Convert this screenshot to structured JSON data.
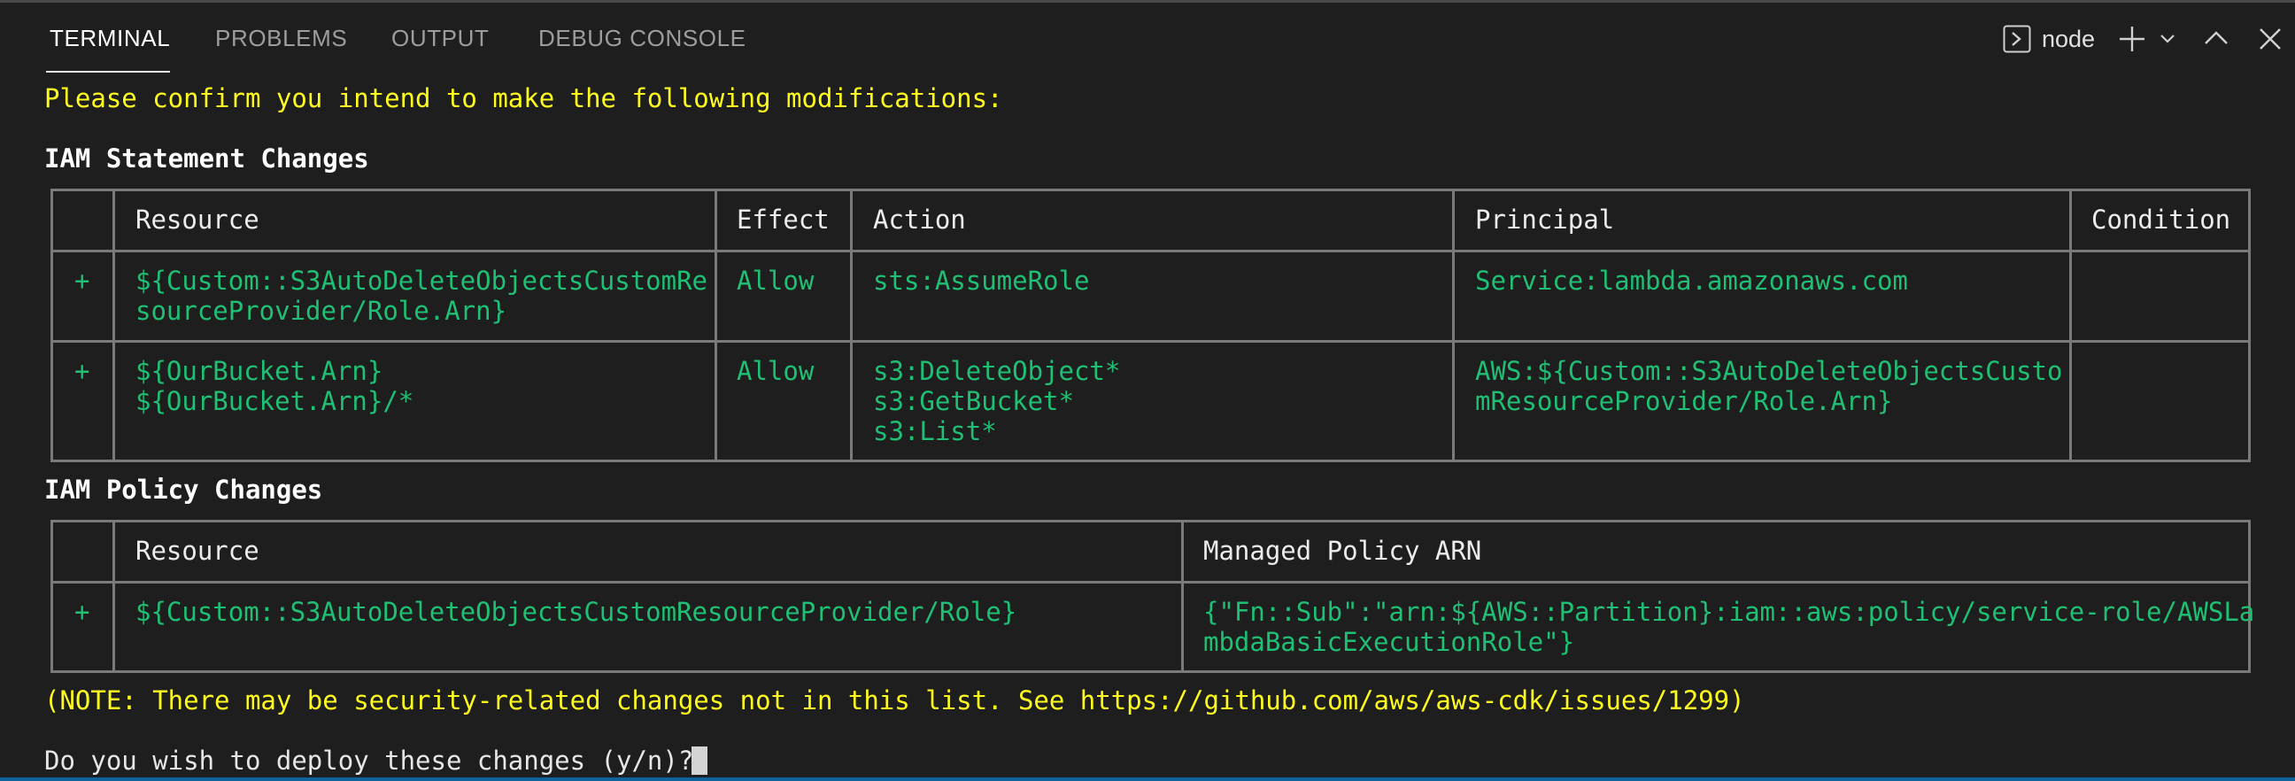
{
  "panel": {
    "tabs": [
      {
        "label": "TERMINAL",
        "active": true
      },
      {
        "label": "PROBLEMS",
        "active": false
      },
      {
        "label": "OUTPUT",
        "active": false
      },
      {
        "label": "DEBUG CONSOLE",
        "active": false
      }
    ],
    "shell_name": "node",
    "icons": [
      "terminal-icon",
      "plus-icon",
      "chevron-down-icon",
      "chevron-up-icon",
      "close-icon"
    ]
  },
  "terminal": {
    "confirm_prompt": "Please confirm you intend to make the following modifications:",
    "iam_statement_heading": "IAM Statement Changes",
    "statement_table": {
      "headers": [
        "",
        "Resource",
        "Effect",
        "Action",
        "Principal",
        "Condition"
      ],
      "rows": [
        {
          "marker": "+",
          "resource": [
            "${Custom::S3AutoDeleteObjectsCustomRe",
            "sourceProvider/Role.Arn}"
          ],
          "effect": "Allow",
          "action": [
            "sts:AssumeRole"
          ],
          "principal": [
            "Service:lambda.amazonaws.com"
          ],
          "condition": ""
        },
        {
          "marker": "+",
          "resource": [
            "${OurBucket.Arn}",
            "${OurBucket.Arn}/*"
          ],
          "effect": "Allow",
          "action": [
            "s3:DeleteObject*",
            "s3:GetBucket*",
            "s3:List*"
          ],
          "principal": [
            "AWS:${Custom::S3AutoDeleteObjectsCusto",
            "mResourceProvider/Role.Arn}"
          ],
          "condition": ""
        }
      ]
    },
    "iam_policy_heading": "IAM Policy Changes",
    "policy_table": {
      "headers": [
        "",
        "Resource",
        "Managed Policy ARN"
      ],
      "rows": [
        {
          "marker": "+",
          "resource": "${Custom::S3AutoDeleteObjectsCustomResourceProvider/Role}",
          "arn": [
            "{\"Fn::Sub\":\"arn:${AWS::Partition}:iam::aws:policy/service-role/AWSLa",
            "mbdaBasicExecutionRole\"}"
          ]
        }
      ]
    },
    "note": "(NOTE: There may be security-related changes not in this list. See https://github.com/aws/aws-cdk/issues/1299)",
    "deploy_prompt": "Do you wish to deploy these changes (y/n)? "
  },
  "colors": {
    "background": "#1e1e1e",
    "yellow_text": "#ffff1e",
    "green_text": "#1fbf74",
    "table_border": "#7a7a7a",
    "status_bar": "#0e639c"
  }
}
